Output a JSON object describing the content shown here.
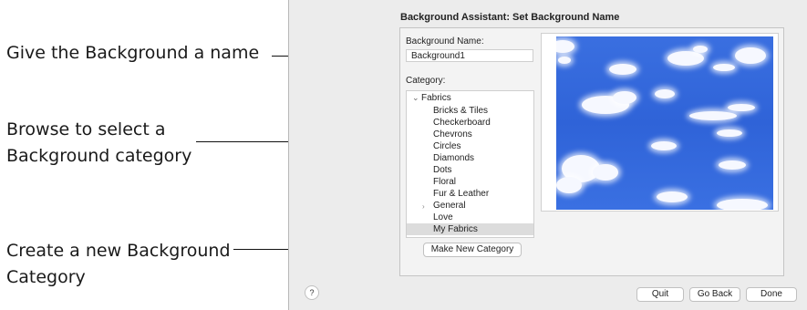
{
  "annotations": {
    "name": "Give the Background a name",
    "browse_line1": "Browse to select a",
    "browse_line2": "Background category",
    "create_line1": "Create a new Background",
    "create_line2": "Category"
  },
  "dialog": {
    "title": "Background Assistant: Set Background Name",
    "name_label": "Background Name:",
    "name_value": "Background1",
    "category_label": "Category:",
    "root_category": "Fabrics",
    "categories": [
      "Bricks & Tiles",
      "Checkerboard",
      "Chevrons",
      "Circles",
      "Diamonds",
      "Dots",
      "Floral",
      "Fur & Leather",
      "General",
      "Love",
      "My Fabrics"
    ],
    "selected_category": "My Fabrics",
    "make_new_button": "Make New Category",
    "help_button": "?",
    "quit_button": "Quit",
    "go_back_button": "Go Back",
    "done_button": "Done",
    "preview_icon": "cloud-sky-fabric-preview",
    "accent_color": "#2f63d8"
  }
}
